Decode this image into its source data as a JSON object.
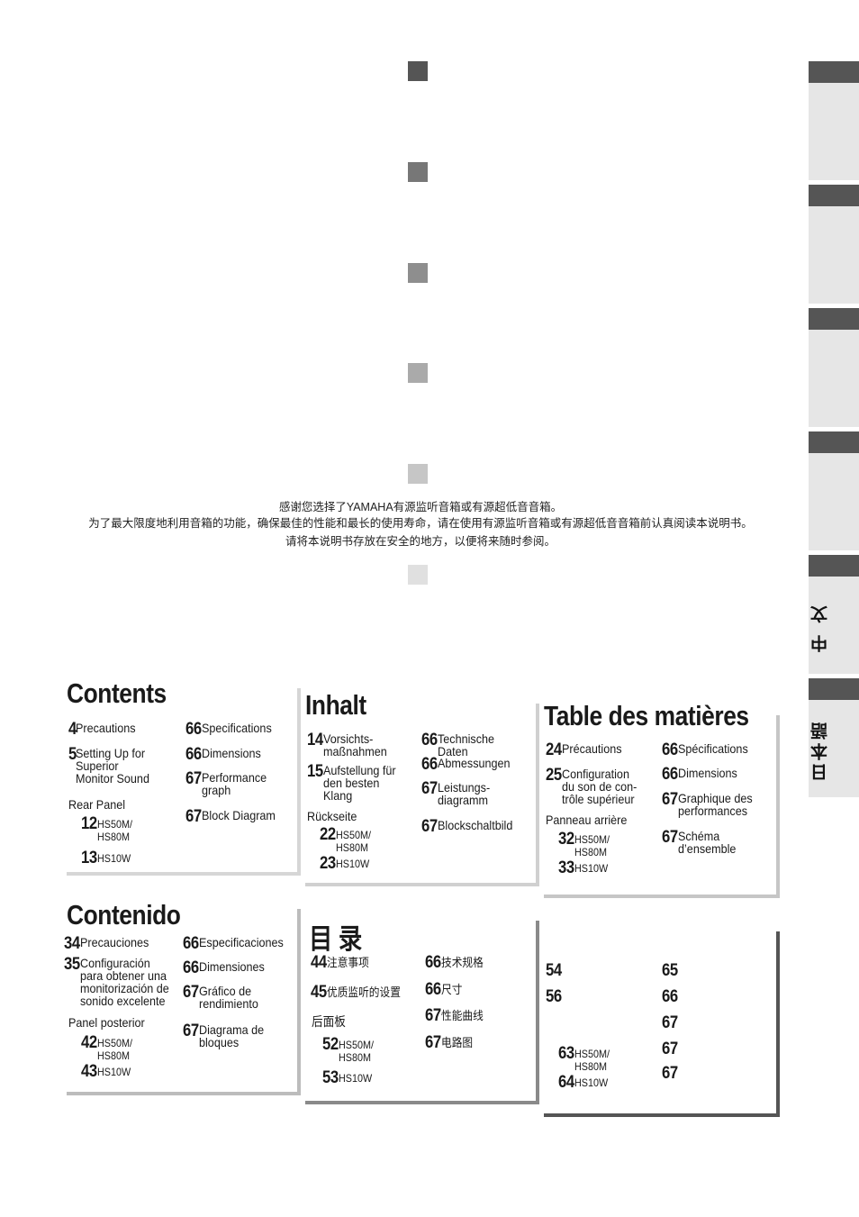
{
  "intro": {
    "lines": [
      "感谢您选择了YAMAHA有源监听音箱或有源超低音音箱。",
      "为了最大限度地利用音箱的功能，确保最佳的性能和最长的使用寿命，请在使用有源监听音箱或有源超低音音箱前认真阅读本说明书。",
      "请将本说明书存放在安全的地方，以便将来随时参阅。"
    ]
  },
  "colors": {
    "squares": [
      "#555555",
      "#777777",
      "#8e8e8e",
      "#aaaaaa",
      "#c6c6c6",
      "#e0e0e0"
    ],
    "tab_header": "#555555",
    "tab_body": "#e6e6e6"
  },
  "side_tabs": [
    {
      "label": ""
    },
    {
      "label": ""
    },
    {
      "label": ""
    },
    {
      "label": ""
    },
    {
      "label": "中 文",
      "active": true
    },
    {
      "label": "日本語"
    }
  ],
  "boxes": [
    {
      "title": "Contents",
      "entries": [
        {
          "num": "4",
          "label": "Precautions"
        },
        {
          "num": "5",
          "label": "Setting Up for\nSuperior\nMonitor Sound"
        },
        {
          "heading": "Rear Panel"
        },
        {
          "num": "12",
          "label": "HS50M/\nHS80M"
        },
        {
          "num": "13",
          "label": "HS10W"
        },
        {
          "num": "66",
          "label": "Specifications"
        },
        {
          "num": "66",
          "label": "Dimensions"
        },
        {
          "num": "67",
          "label": "Performance\ngraph"
        },
        {
          "num": "67",
          "label": "Block Diagram"
        }
      ]
    },
    {
      "title": "Inhalt",
      "entries": [
        {
          "num": "14",
          "label": "Vorsichts-\nmaßnahmen"
        },
        {
          "num": "15",
          "label": "Aufstellung für\nden besten\nKlang"
        },
        {
          "heading": "Rückseite"
        },
        {
          "num": "22",
          "label": "HS50M/\nHS80M"
        },
        {
          "num": "23",
          "label": "HS10W"
        },
        {
          "num": "66",
          "label": "Technische Daten"
        },
        {
          "num": "66",
          "label": "Abmessungen"
        },
        {
          "num": "67",
          "label": "Leistungs-\ndiagramm"
        },
        {
          "num": "67",
          "label": "Blockschaltbild"
        }
      ]
    },
    {
      "title": "Table des matières",
      "entries": [
        {
          "num": "24",
          "label": "Précautions"
        },
        {
          "num": "25",
          "label": "Configuration\ndu son de con-\ntrôle supérieur"
        },
        {
          "heading": "Panneau arrière"
        },
        {
          "num": "32",
          "label": "HS50M/\nHS80M"
        },
        {
          "num": "33",
          "label": "HS10W"
        },
        {
          "num": "66",
          "label": "Spécifications"
        },
        {
          "num": "66",
          "label": "Dimensions"
        },
        {
          "num": "67",
          "label": "Graphique des\nperformances"
        },
        {
          "num": "67",
          "label": "Schéma\nd’ensemble"
        }
      ]
    },
    {
      "title": "Contenido",
      "entries": [
        {
          "num": "34",
          "label": "Precauciones"
        },
        {
          "num": "35",
          "label": "Configuración\npara obtener una\nmonitorización de\nsonido excelente"
        },
        {
          "heading": "Panel posterior"
        },
        {
          "num": "42",
          "label": "HS50M/\nHS80M"
        },
        {
          "num": "43",
          "label": "HS10W"
        },
        {
          "num": "66",
          "label": "Especificaciones"
        },
        {
          "num": "66",
          "label": "Dimensiones"
        },
        {
          "num": "67",
          "label": "Gráfico de\nrendimiento"
        },
        {
          "num": "67",
          "label": "Diagrama de\nbloques"
        }
      ]
    },
    {
      "title": "目 录",
      "entries": [
        {
          "num": "44",
          "label": "注意事项"
        },
        {
          "num": "45",
          "label": "优质监听的设置"
        },
        {
          "heading": "后面板"
        },
        {
          "num": "52",
          "label": "HS50M/\nHS80M"
        },
        {
          "num": "53",
          "label": "HS10W"
        },
        {
          "num": "66",
          "label": "技术规格"
        },
        {
          "num": "66",
          "label": "尺寸"
        },
        {
          "num": "67",
          "label": "性能曲线"
        },
        {
          "num": "67",
          "label": "电路图"
        }
      ]
    },
    {
      "title": "",
      "entries": [
        {
          "num": "54",
          "label": ""
        },
        {
          "num": "56",
          "label": ""
        },
        {
          "num": "63",
          "label": "HS50M/\nHS80M"
        },
        {
          "num": "64",
          "label": "HS10W"
        },
        {
          "num": "65",
          "label": ""
        },
        {
          "num": "66",
          "label": ""
        },
        {
          "num": "67",
          "label": ""
        },
        {
          "num": "67",
          "label": ""
        },
        {
          "num": "67",
          "label": ""
        }
      ]
    }
  ]
}
